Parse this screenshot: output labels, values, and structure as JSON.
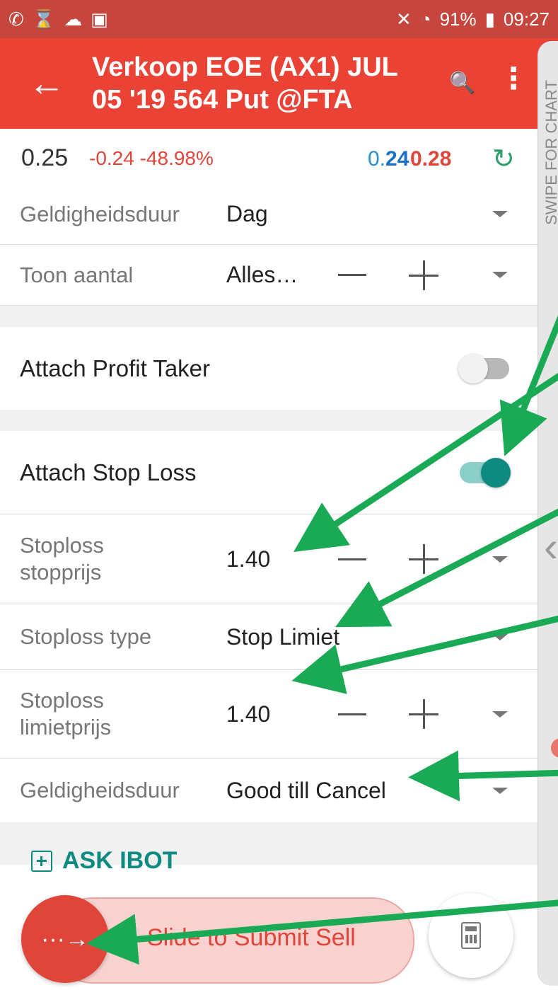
{
  "status_bar": {
    "signal_pct": "91%",
    "time": "09:27"
  },
  "app_bar": {
    "title": "Verkoop EOE (AX1) JUL 05 '19 564 Put @FTA"
  },
  "quote": {
    "last": "0.25",
    "change": "-0.24 -48.98%",
    "bid_prefix": "0.",
    "bid_bold": "24",
    "ask": "0.28"
  },
  "order_rows": [
    {
      "label": "Geldigheidsduur",
      "value": "Dag"
    },
    {
      "label": "Toon aantal",
      "value": "Alles…"
    }
  ],
  "profit_taker": {
    "label": "Attach Profit Taker",
    "enabled": false
  },
  "stop_loss": {
    "label": "Attach Stop Loss",
    "enabled": true,
    "rows": [
      {
        "label": "Stoploss stopprijs",
        "value": "1.40"
      },
      {
        "label": "Stoploss type",
        "value": "Stop Limiet"
      },
      {
        "label": "Stoploss limietprijs",
        "value": "1.40"
      },
      {
        "label": "Geldigheidsduur",
        "value": "Good till Cancel"
      }
    ]
  },
  "ask_ibot": "ASK IBOT",
  "submit": {
    "label": "Slide to Submit Sell"
  },
  "drawer": {
    "label": "SWIPE FOR CHART"
  },
  "colors": {
    "header": "#ea4335",
    "teal": "#0e8a80",
    "annotation": "#1aaa55"
  },
  "icons": [
    "back-arrow-icon",
    "search-icon",
    "more-vert-icon",
    "refresh-icon",
    "dropdown-icon",
    "calculator-icon",
    "slide-arrow-icon"
  ]
}
